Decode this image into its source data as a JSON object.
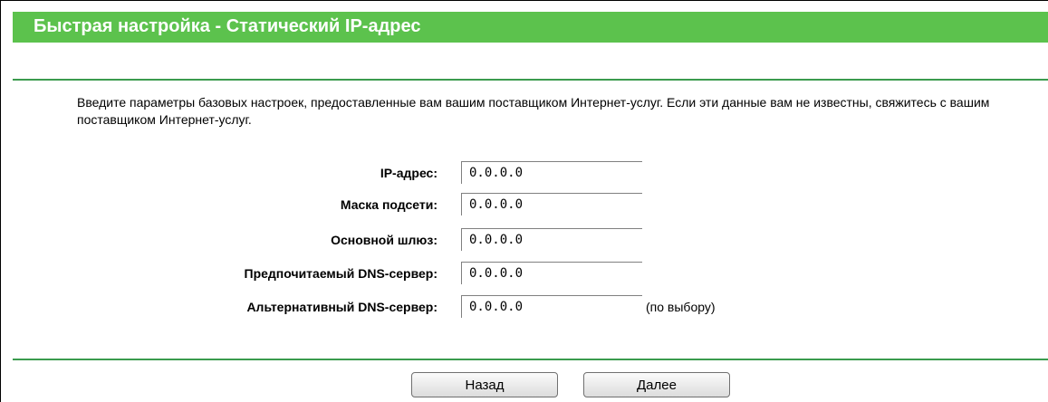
{
  "header": {
    "title": "Быстрая настройка - Статический IP-адрес"
  },
  "description": "Введите параметры базовых настроек, предоставленные вам вашим поставщиком Интернет-услуг. Если эти данные вам не известны, свяжитесь с вашим поставщиком Интернет-услуг.",
  "form": {
    "fields": [
      {
        "label": "IP-адрес:",
        "value": "0.0.0.0"
      },
      {
        "label": "Маска подсети:",
        "value": "0.0.0.0"
      },
      {
        "label": "Основной шлюз:",
        "value": "0.0.0.0"
      },
      {
        "label": "Предпочитаемый DNS-сервер:",
        "value": "0.0.0.0"
      },
      {
        "label": "Альтернативный DNS-сервер:",
        "value": "0.0.0.0",
        "note": "(по выбору)"
      }
    ]
  },
  "buttons": {
    "back": "Назад",
    "next": "Далее"
  },
  "colors": {
    "header_bg": "#5cc24d",
    "rule": "#3b9b4e"
  }
}
